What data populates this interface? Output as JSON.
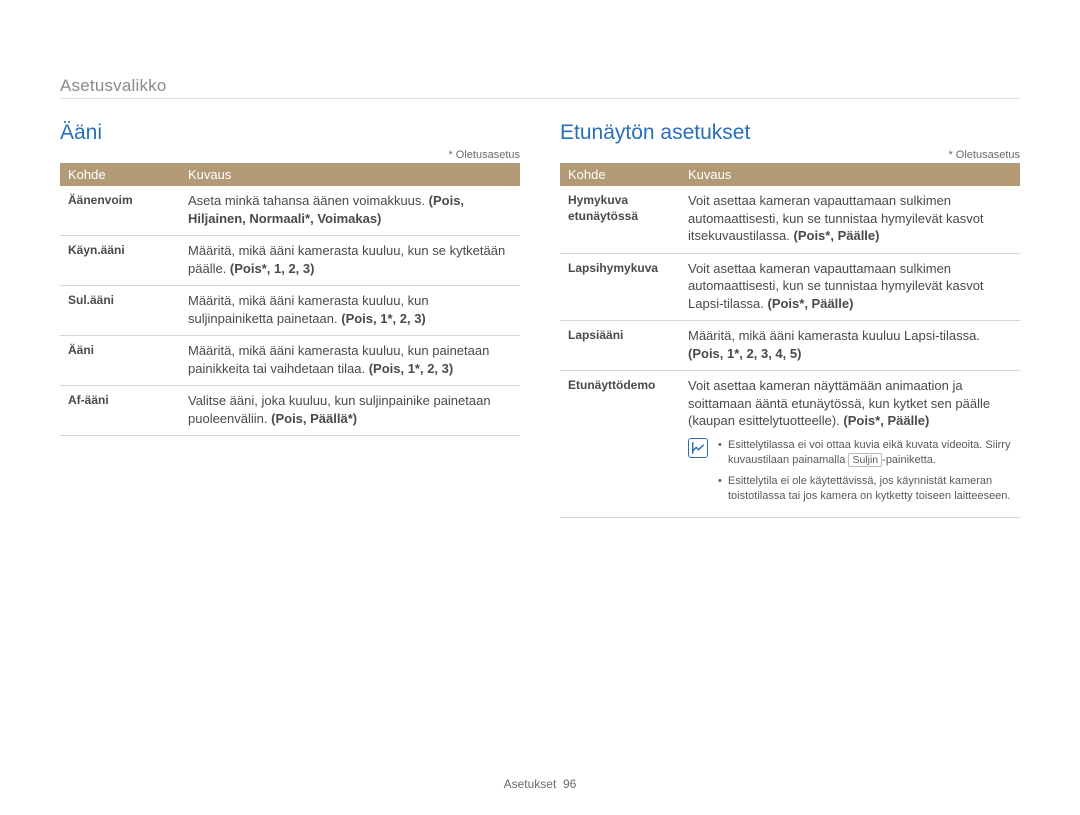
{
  "breadcrumb": "Asetusvalikko",
  "default_note": "* Oletusasetus",
  "table_headers": {
    "kohde": "Kohde",
    "kuvaus": "Kuvaus"
  },
  "left": {
    "title": "Ääni",
    "rows": [
      {
        "label": "Äänenvoim",
        "desc_plain": "Aseta minkä tahansa äänen voimakkuus. ",
        "desc_bold": "(Pois, Hiljainen, Normaali*, Voimakas)"
      },
      {
        "label": "Käyn.ääni",
        "desc_plain": "Määritä, mikä ääni kamerasta kuuluu, kun se kytketään päälle. ",
        "desc_bold": "(Pois*, 1, 2, 3)"
      },
      {
        "label": "Sul.ääni",
        "desc_plain": "Määritä, mikä ääni kamerasta kuuluu, kun suljinpainiketta painetaan. ",
        "desc_bold": "(Pois, 1*, 2, 3)"
      },
      {
        "label": "Ääni",
        "desc_plain": "Määritä, mikä ääni kamerasta kuuluu, kun painetaan painikkeita tai vaihdetaan tilaa. ",
        "desc_bold": "(Pois, 1*, 2, 3)"
      },
      {
        "label": "Af-ääni",
        "desc_plain": "Valitse ääni, joka kuuluu, kun suljinpainike painetaan puoleenväliin. ",
        "desc_bold": "(Pois, Päällä*)"
      }
    ]
  },
  "right": {
    "title": "Etunäytön asetukset",
    "rows": [
      {
        "label": "Hymykuva etunäytössä",
        "desc_plain": "Voit asettaa kameran vapauttamaan sulkimen automaattisesti, kun se tunnistaa hymyilevät kasvot itsekuvaustilassa. ",
        "desc_bold": "(Pois*, Päälle)"
      },
      {
        "label": "Lapsihymykuva",
        "desc_plain": "Voit asettaa kameran vapauttamaan sulkimen automaattisesti, kun se tunnistaa hymyilevät kasvot Lapsi-tilassa. ",
        "desc_bold": "(Pois*, Päälle)"
      },
      {
        "label": "Lapsiääni",
        "desc_plain": "Määritä, mikä ääni kamerasta kuuluu Lapsi-tilassa. ",
        "desc_bold": "(Pois, 1*, 2, 3, 4, 5)"
      }
    ],
    "demo": {
      "label": "Etunäyttödemo",
      "desc_plain": "Voit asettaa kameran näyttämään animaation ja soittamaan ääntä etunäytössä, kun kytket sen päälle (kaupan esittelytuotteelle). ",
      "desc_bold": "(Pois*, Päälle)",
      "note1_a": "Esittelytilassa ei voi ottaa kuvia eikä kuvata videoita. Siirry kuvaustilaan painamalla ",
      "note1_box": "Suljin",
      "note1_b": "-painiketta.",
      "note2": "Esittelytila ei ole käytettävissä, jos käynnistät kameran toistotilassa tai jos kamera on kytketty toiseen laitteeseen."
    }
  },
  "footer": {
    "label": "Asetukset",
    "page": "96"
  }
}
